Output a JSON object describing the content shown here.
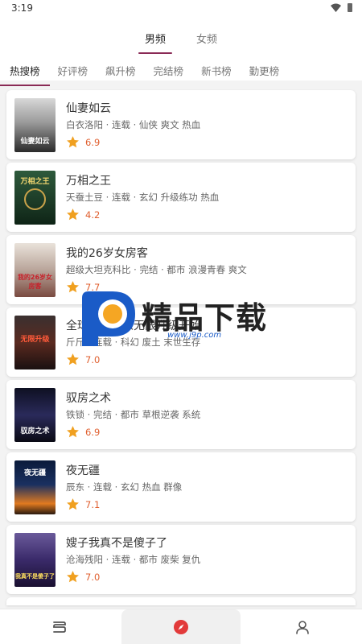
{
  "status": {
    "time": "3:19"
  },
  "gender_tabs": [
    {
      "label": "男频",
      "active": true
    },
    {
      "label": "女频",
      "active": false
    }
  ],
  "rank_tabs": [
    {
      "label": "热搜榜",
      "active": true
    },
    {
      "label": "好评榜",
      "active": false
    },
    {
      "label": "飙升榜",
      "active": false
    },
    {
      "label": "完结榜",
      "active": false
    },
    {
      "label": "新书榜",
      "active": false
    },
    {
      "label": "勤更榜",
      "active": false
    }
  ],
  "books": [
    {
      "title": "仙妻如云",
      "meta": "白衣洛阳 · 连载 · 仙侠 爽文 热血",
      "score": "6.9",
      "cover_text": "仙妻如云"
    },
    {
      "title": "万相之王",
      "meta": "天蚕土豆 · 连载 · 玄幻 升级练功 热血",
      "score": "4.2",
      "cover_text": "万相之王"
    },
    {
      "title": "我的26岁女房客",
      "meta": "超级大坦克科比 · 完结 · 都市 浪漫青春 爽文",
      "score": "7.7",
      "cover_text": "我的26岁女房客"
    },
    {
      "title": "全球废土：从无限升级开始",
      "meta": "斤斤 · 连载 · 科幻 废土 末世生存",
      "score": "7.0",
      "cover_text": "无限升级"
    },
    {
      "title": "驭房之术",
      "meta": "铁锁 · 完结 · 都市 草根逆袭 系统",
      "score": "6.9",
      "cover_text": "驭房之术"
    },
    {
      "title": "夜无疆",
      "meta": "辰东 · 连载 · 玄幻 热血 群像",
      "score": "7.1",
      "cover_text": "夜无疆"
    },
    {
      "title": "嫂子我真不是傻子了",
      "meta": "沧海残阳 · 连载 · 都市 废柴 复仇",
      "score": "7.0",
      "cover_text": "我真不是傻子了"
    }
  ],
  "watermark": {
    "text": "精品下载",
    "url": "www.j9p.com"
  },
  "colors": {
    "accent": "#8a2a55",
    "star": "#f0a020",
    "score": "#e06030",
    "nav_active": "#e23a3a"
  }
}
